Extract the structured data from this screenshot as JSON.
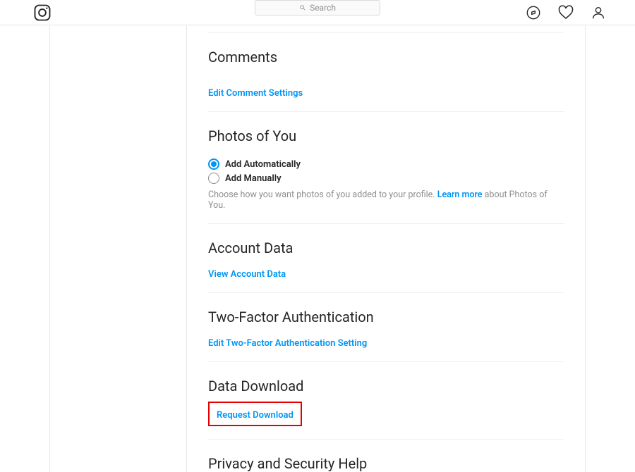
{
  "header": {
    "search_placeholder": "Search"
  },
  "sections": {
    "comments": {
      "title": "Comments",
      "link": "Edit Comment Settings"
    },
    "photos": {
      "title": "Photos of You",
      "opt_auto": "Add Automatically",
      "opt_manual": "Add Manually",
      "helper_pre": "Choose how you want photos of you added to your profile. ",
      "helper_link": "Learn more",
      "helper_post": " about Photos of You."
    },
    "account_data": {
      "title": "Account Data",
      "link": "View Account Data"
    },
    "two_factor": {
      "title": "Two-Factor Authentication",
      "link": "Edit Two-Factor Authentication Setting"
    },
    "data_download": {
      "title": "Data Download",
      "link": "Request Download"
    },
    "privacy_help": {
      "title": "Privacy and Security Help"
    }
  }
}
